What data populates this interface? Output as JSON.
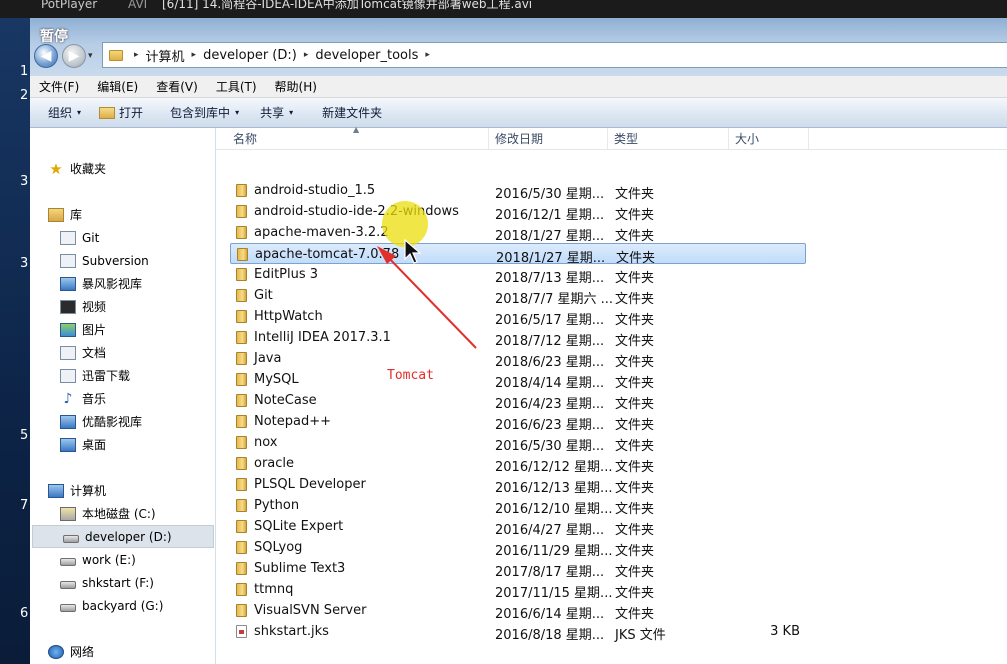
{
  "player": {
    "app_name": "PotPlayer",
    "format": "AVI",
    "file_title": "[6/11] 14.简程谷-IDEA-IDEA中添加Tomcat镜像并部署web工程.avi"
  },
  "desktop": {
    "edge_numbers": [
      "1",
      "2",
      "3",
      "3",
      "5",
      "7",
      "6"
    ]
  },
  "window": {
    "overlay_status": "暂停",
    "nav": {
      "back_icon": "◀",
      "forward_icon": "▶",
      "recent_icon": "▾"
    },
    "breadcrumb": {
      "items": [
        "计算机",
        "developer (D:)",
        "developer_tools"
      ],
      "separator": "▸"
    },
    "menu": [
      "文件(F)",
      "编辑(E)",
      "查看(V)",
      "工具(T)",
      "帮助(H)"
    ],
    "toolbar": {
      "organize": "组织",
      "open": "打开",
      "include_in_library": "包含到库中",
      "share": "共享",
      "new_folder": "新建文件夹",
      "caret": "▾"
    }
  },
  "sidebar": {
    "favorites": "收藏夹",
    "libraries": "库",
    "library_items": [
      "Git",
      "Subversion",
      "暴风影视库",
      "视频",
      "图片",
      "文档",
      "迅雷下载",
      "音乐",
      "优酷影视库",
      "桌面"
    ],
    "computer": "计算机",
    "drives": [
      "本地磁盘 (C:)",
      "developer (D:)",
      "work (E:)",
      "shkstart (F:)",
      "backyard (G:)"
    ],
    "selected_drive": "developer (D:)",
    "network": "网络"
  },
  "columns": {
    "name": "名称",
    "date": "修改日期",
    "type": "类型",
    "size": "大小",
    "sort_indicator": "▲"
  },
  "files": [
    {
      "name": "android-studio_1.5",
      "date": "2016/5/30 星期...",
      "type": "文件夹",
      "size": "",
      "kind": "folder"
    },
    {
      "name": "android-studio-ide-2.2-windows",
      "date": "2016/12/1 星期...",
      "type": "文件夹",
      "size": "",
      "kind": "folder"
    },
    {
      "name": "apache-maven-3.2.2",
      "date": "2018/1/27 星期...",
      "type": "文件夹",
      "size": "",
      "kind": "folder"
    },
    {
      "name": "apache-tomcat-7.0.78",
      "date": "2018/1/27 星期...",
      "type": "文件夹",
      "size": "",
      "kind": "folder",
      "selected": true
    },
    {
      "name": "EditPlus 3",
      "date": "2018/7/13 星期...",
      "type": "文件夹",
      "size": "",
      "kind": "folder"
    },
    {
      "name": "Git",
      "date": "2018/7/7 星期六 ...",
      "type": "文件夹",
      "size": "",
      "kind": "folder"
    },
    {
      "name": "HttpWatch",
      "date": "2016/5/17 星期...",
      "type": "文件夹",
      "size": "",
      "kind": "folder"
    },
    {
      "name": "IntelliJ IDEA 2017.3.1",
      "date": "2018/7/12 星期...",
      "type": "文件夹",
      "size": "",
      "kind": "folder"
    },
    {
      "name": "Java",
      "date": "2018/6/23 星期...",
      "type": "文件夹",
      "size": "",
      "kind": "folder"
    },
    {
      "name": "MySQL",
      "date": "2018/4/14 星期...",
      "type": "文件夹",
      "size": "",
      "kind": "folder"
    },
    {
      "name": "NoteCase",
      "date": "2016/4/23 星期...",
      "type": "文件夹",
      "size": "",
      "kind": "folder"
    },
    {
      "name": "Notepad++",
      "date": "2016/6/23 星期...",
      "type": "文件夹",
      "size": "",
      "kind": "folder"
    },
    {
      "name": "nox",
      "date": "2016/5/30 星期...",
      "type": "文件夹",
      "size": "",
      "kind": "folder"
    },
    {
      "name": "oracle",
      "date": "2016/12/12 星期...",
      "type": "文件夹",
      "size": "",
      "kind": "folder"
    },
    {
      "name": "PLSQL Developer",
      "date": "2016/12/13 星期...",
      "type": "文件夹",
      "size": "",
      "kind": "folder"
    },
    {
      "name": "Python",
      "date": "2016/12/10 星期...",
      "type": "文件夹",
      "size": "",
      "kind": "folder"
    },
    {
      "name": "SQLite Expert",
      "date": "2016/4/27 星期...",
      "type": "文件夹",
      "size": "",
      "kind": "folder"
    },
    {
      "name": "SQLyog",
      "date": "2016/11/29 星期...",
      "type": "文件夹",
      "size": "",
      "kind": "folder"
    },
    {
      "name": "Sublime Text3",
      "date": "2017/8/17 星期...",
      "type": "文件夹",
      "size": "",
      "kind": "folder"
    },
    {
      "name": "ttmnq",
      "date": "2017/11/15 星期...",
      "type": "文件夹",
      "size": "",
      "kind": "folder"
    },
    {
      "name": "VisualSVN Server",
      "date": "2016/6/14 星期...",
      "type": "文件夹",
      "size": "",
      "kind": "folder"
    },
    {
      "name": "shkstart.jks",
      "date": "2016/8/18 星期...",
      "type": "JKS 文件",
      "size": "3 KB",
      "kind": "file"
    }
  ],
  "annotation": {
    "label": "Tomcat",
    "color": "#e0302c",
    "highlight_color": "#ecde0a"
  }
}
